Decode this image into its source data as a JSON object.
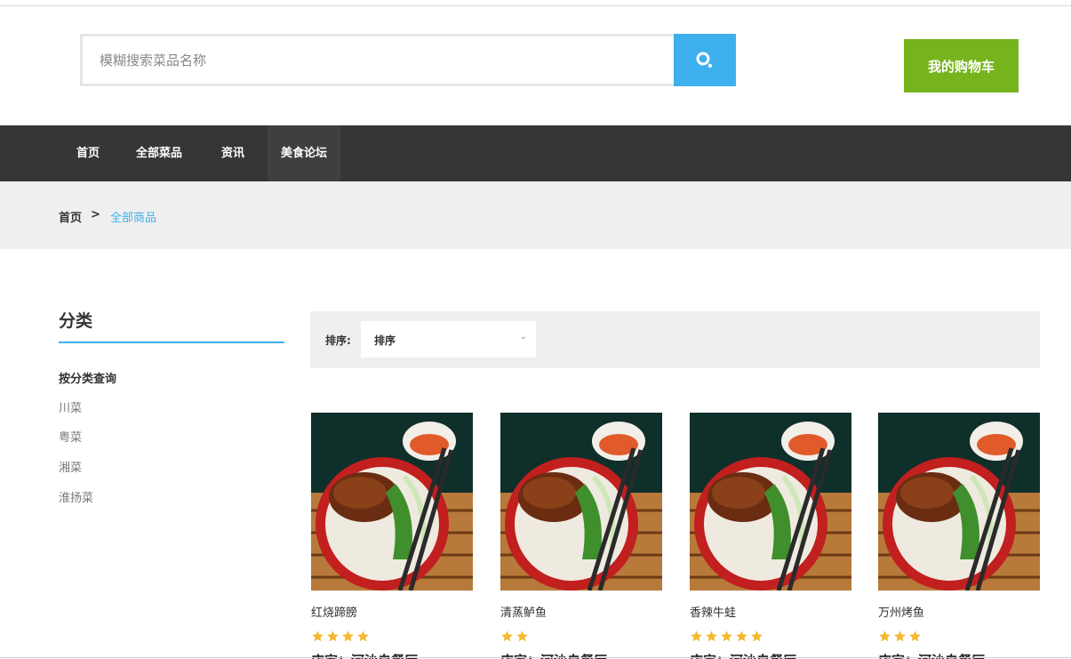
{
  "header": {
    "search_placeholder": "模糊搜索菜品名称",
    "search_icon": "search-icon",
    "cart_label": "我的购物车"
  },
  "nav": {
    "items": [
      "首页",
      "全部菜品",
      "资讯",
      "美食论坛"
    ],
    "active": "美食论坛"
  },
  "breadcrumb": {
    "home": "首页",
    "separator": ">",
    "current": "全部商品"
  },
  "sidebar": {
    "title": "分类",
    "subtitle": "按分类查询",
    "categories": [
      "川菜",
      "粤菜",
      "湘菜",
      "淮扬菜"
    ]
  },
  "sort": {
    "label": "排序:",
    "selected": "排序"
  },
  "products": [
    {
      "name": "红烧蹄膀",
      "rating": 4,
      "shop": "店家：河沙自餐厅"
    },
    {
      "name": "清蒸鲈鱼",
      "rating": 2,
      "shop": "店家：河沙自餐厅"
    },
    {
      "name": "香辣牛蛙",
      "rating": 5,
      "shop": "店家：河沙自餐厅"
    },
    {
      "name": "万州烤鱼",
      "rating": 3,
      "shop": "店家：河沙自餐厅"
    }
  ],
  "colors": {
    "accent_blue": "#3fb0ee",
    "cart_green": "#76b41e",
    "nav_dark": "#363636",
    "star_gold": "#f5b82e"
  }
}
